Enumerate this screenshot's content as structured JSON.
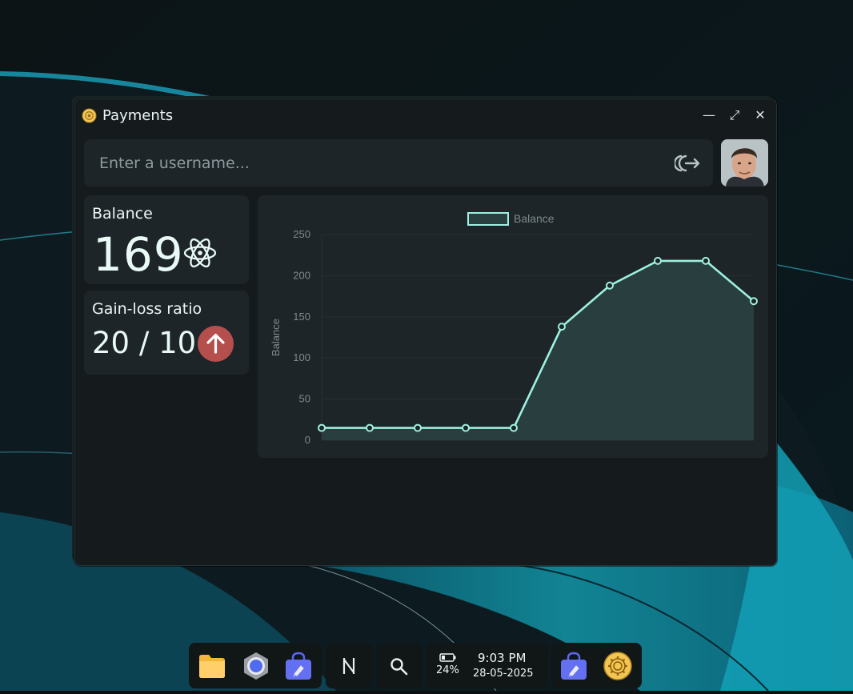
{
  "window": {
    "title": "Payments"
  },
  "search": {
    "placeholder": "Enter a username..."
  },
  "balance": {
    "label": "Balance",
    "value": "169"
  },
  "ratio": {
    "label": "Gain-loss ratio",
    "value": "20 / 10"
  },
  "chart_data": {
    "type": "area",
    "legend": [
      "Balance"
    ],
    "legend_position": "top",
    "ylabel": "Balance",
    "xlabel": "",
    "ylim": [
      0,
      250
    ],
    "yticks": [
      0,
      50,
      100,
      150,
      200,
      250
    ],
    "grid": true,
    "series": [
      {
        "name": "Balance",
        "values": [
          15,
          15,
          15,
          15,
          15,
          138,
          188,
          218,
          218,
          169
        ]
      }
    ],
    "colors": {
      "line": "#9ef0e0",
      "fill": "#2a3f3f"
    }
  },
  "taskbar": {
    "battery": "24%",
    "time": "9:03 PM",
    "date": "28-05-2025",
    "icons": [
      "folder-icon",
      "browser-icon",
      "store-icon",
      "notes-icon",
      "search-icon",
      "store-icon",
      "settings-icon"
    ]
  }
}
